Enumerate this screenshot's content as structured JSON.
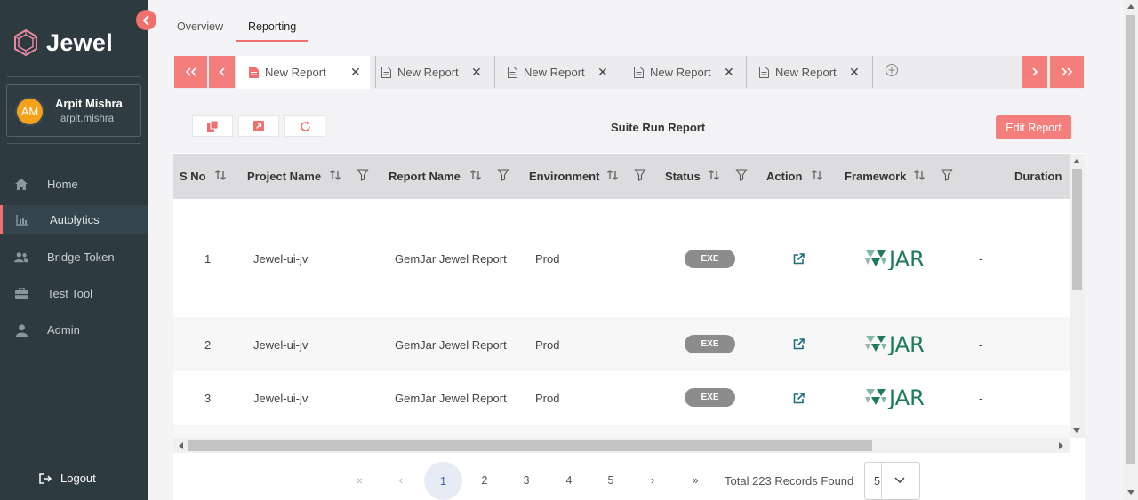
{
  "sidebar": {
    "brand": "Jewel",
    "user": {
      "initials": "AM",
      "name": "Arpit Mishra",
      "handle": "arpit.mishra"
    },
    "items": [
      {
        "label": "Home",
        "icon": "home-icon"
      },
      {
        "label": "Autolytics",
        "icon": "chart-icon",
        "active": true
      },
      {
        "label": "Bridge Token",
        "icon": "users-icon"
      },
      {
        "label": "Test Tool",
        "icon": "toolbox-icon"
      },
      {
        "label": "Admin",
        "icon": "user-icon"
      }
    ],
    "logout": "Logout"
  },
  "top_tabs": [
    {
      "label": "Overview"
    },
    {
      "label": "Reporting",
      "active": true
    }
  ],
  "report_tabs": [
    {
      "label": "New Report",
      "active": true
    },
    {
      "label": "New Report"
    },
    {
      "label": "New Report"
    },
    {
      "label": "New Report"
    },
    {
      "label": "New Report"
    }
  ],
  "panel": {
    "title": "Suite Run Report",
    "edit_label": "Edit Report"
  },
  "table": {
    "columns": [
      "S No",
      "Project Name",
      "Report Name",
      "Environment",
      "Status",
      "Action",
      "Framework",
      "Duration"
    ],
    "rows": [
      {
        "sno": "1",
        "project": "Jewel-ui-jv",
        "report": "GemJar Jewel Report",
        "env": "Prod",
        "status": "EXE",
        "framework": "JAR",
        "duration": "-"
      },
      {
        "sno": "2",
        "project": "Jewel-ui-jv",
        "report": "GemJar Jewel Report",
        "env": "Prod",
        "status": "EXE",
        "framework": "JAR",
        "duration": "-"
      },
      {
        "sno": "3",
        "project": "Jewel-ui-jv",
        "report": "GemJar Jewel Report",
        "env": "Prod",
        "status": "EXE",
        "framework": "JAR",
        "duration": "-"
      }
    ]
  },
  "pagination": {
    "first": "«",
    "prev": "‹",
    "pages": [
      "1",
      "2",
      "3",
      "4",
      "5"
    ],
    "current": "1",
    "next": "›",
    "last": "»",
    "records": "Total 223 Records Found",
    "page_size": "5"
  },
  "colors": {
    "accent": "#f16f6d",
    "sidebar": "#2d3a40",
    "jar_green": "#1f7a5a"
  }
}
